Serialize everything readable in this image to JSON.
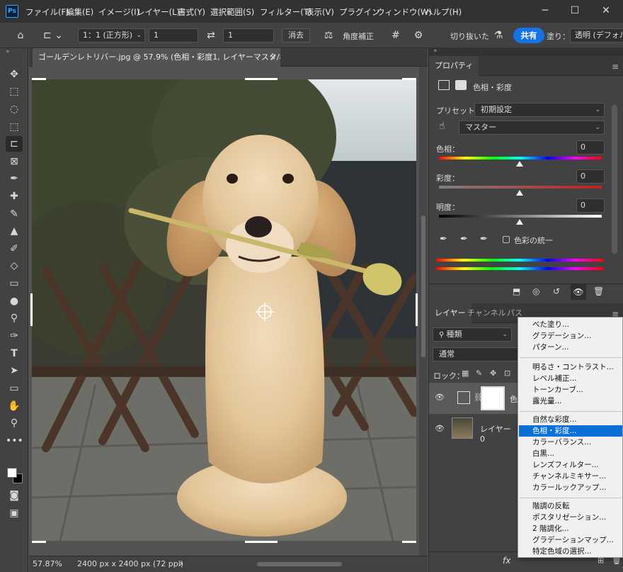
{
  "menubar": {
    "logo": "Ps",
    "items": [
      "ファイル(F)",
      "編集(E)",
      "イメージ(I)",
      "レイヤー(L)",
      "書式(Y)",
      "選択範囲(S)",
      "フィルター(T)",
      "表示(V)",
      "プラグイン",
      "ウィンドウ(W)",
      "ヘルプ(H)"
    ]
  },
  "options": {
    "ratio_select": "1：1 (正方形)",
    "width_value": "1",
    "height_value": "1",
    "clear_button": "消去",
    "straighten_label": "角度補正",
    "delete_cropped_label": "切り抜いた",
    "share_button": "共有",
    "fill_label": "塗り：",
    "fill_value": "透明 (デフォル"
  },
  "document": {
    "tab_title": "ゴールデンレトリバー.jpg @ 57.9% (色相・彩度1, レイヤーマスク/8) *",
    "tab_close": "×"
  },
  "status": {
    "zoom": "57.87%",
    "doc_size": "2400 px x 2400 px (72 ppi)",
    "arrow": "›"
  },
  "properties": {
    "tab": "プロパティ",
    "adjustment_name": "色相・彩度",
    "preset_label": "プリセット：",
    "preset_value": "初期設定",
    "channel_value": "マスター",
    "hue_label": "色相：",
    "hue_value": "0",
    "sat_label": "彩度：",
    "sat_value": "0",
    "light_label": "明度：",
    "light_value": "0",
    "colorize_label": "色彩の統一"
  },
  "layers": {
    "tabs": [
      "レイヤー",
      "チャンネル",
      "パス"
    ],
    "filter_label": "種類",
    "blend_mode": "通常",
    "lock_label": "ロック：",
    "rows": [
      {
        "name": "色"
      },
      {
        "name": "レイヤー 0"
      }
    ],
    "footer_fx": "fx"
  },
  "dropdown": {
    "groups": [
      [
        "べた塗り...",
        "グラデーション...",
        "パターン..."
      ],
      [
        "明るさ・コントラスト...",
        "レベル補正...",
        "トーンカーブ...",
        "露光量..."
      ],
      [
        "自然な彩度...",
        "色相・彩度...",
        "カラーバランス...",
        "白黒...",
        "レンズフィルター...",
        "チャンネルミキサー...",
        "カラールックアップ..."
      ],
      [
        "階調の反転",
        "ポスタリゼーション...",
        "2 階調化...",
        "グラデーションマップ...",
        "特定色域の選択..."
      ]
    ],
    "highlighted": "色相・彩度..."
  },
  "colors": {
    "accent": "#0a70d9",
    "share": "#1473e6",
    "panel_bg": "#424242",
    "canvas_bg": "#535353"
  }
}
